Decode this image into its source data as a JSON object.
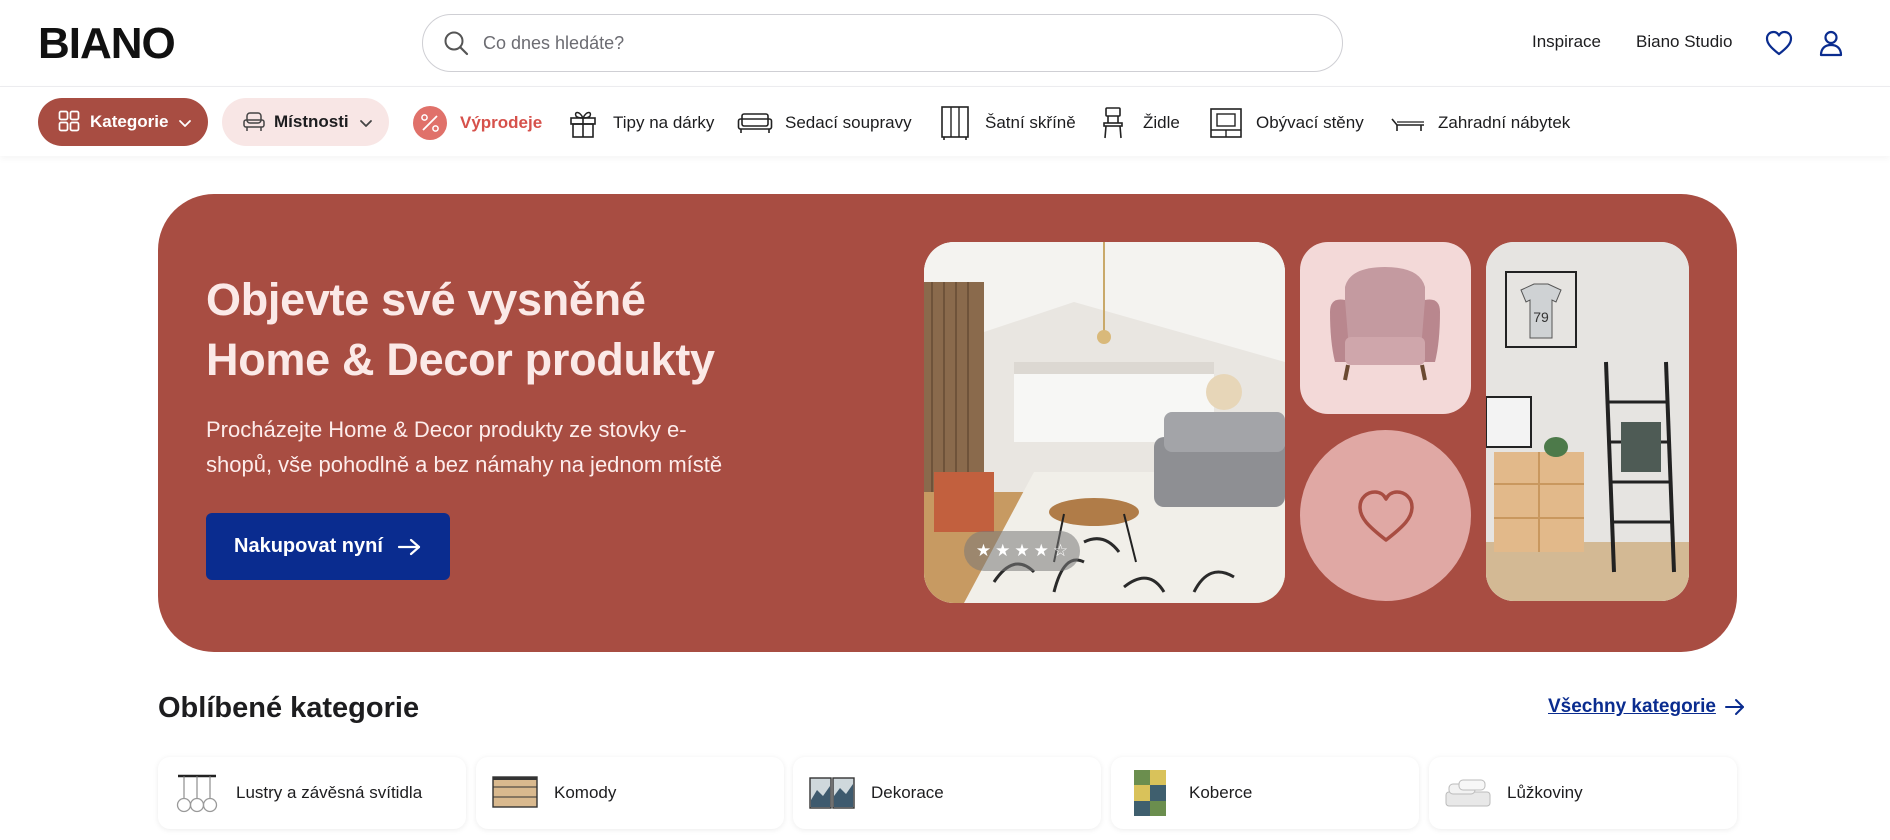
{
  "header": {
    "logo": "BIANO",
    "search_placeholder": "Co dnes hledáte?",
    "links": [
      "Inspirace",
      "Biano Studio"
    ]
  },
  "nav": {
    "kategorie": "Kategorie",
    "mistnosti": "Místnosti",
    "items": [
      "Výprodeje",
      "Tipy na dárky",
      "Sedací soupravy",
      "Šatní skříně",
      "Židle",
      "Obývací stěny",
      "Zahradní nábytek"
    ]
  },
  "hero": {
    "title_line1": "Objevte své vysněné",
    "title_line2": "Home & Decor produkty",
    "subtitle": "Procházejte Home & Decor produkty ze stovky e-shopů, vše pohodlně a bez námahy na jednom místě",
    "cta": "Nakupovat nyní",
    "rating": 4
  },
  "categories": {
    "title": "Oblíbené kategorie",
    "all_link": "Všechny kategorie",
    "items": [
      "Lustry a závěsná svítidla",
      "Komody",
      "Dekorace",
      "Koberce",
      "Lůžkoviny"
    ]
  },
  "colors": {
    "brand_red": "#a84d42",
    "cta_blue": "#0a2c8f",
    "sale_red": "#d6514b"
  }
}
